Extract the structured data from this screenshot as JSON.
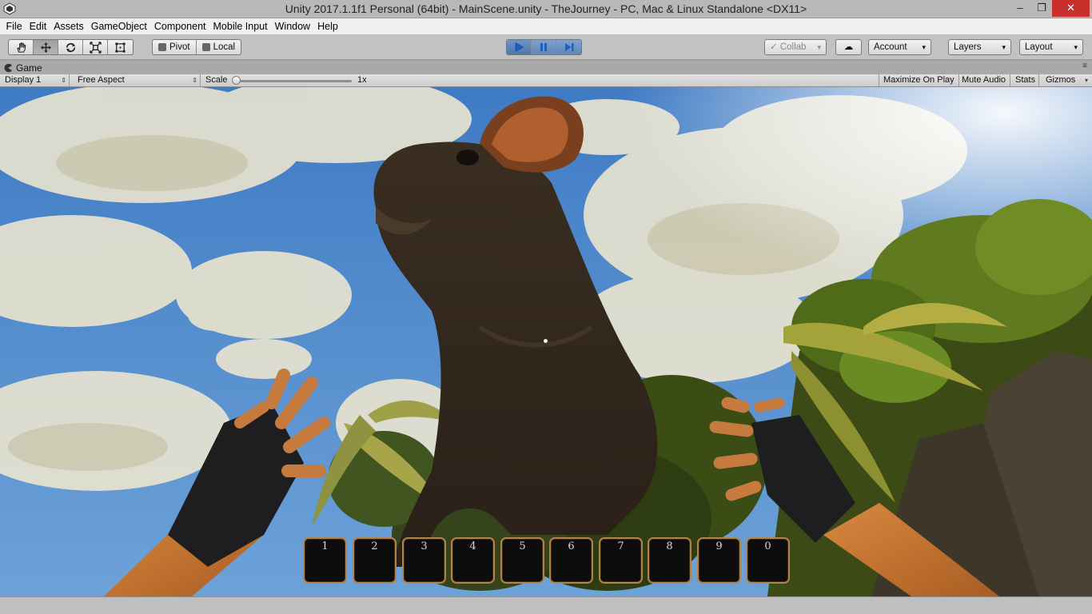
{
  "window": {
    "title": "Unity 2017.1.1f1 Personal (64bit) - MainScene.unity - TheJourney - PC, Mac & Linux Standalone <DX11>",
    "minimize": "–",
    "maximize": "❐",
    "close": "✕"
  },
  "menu": [
    "File",
    "Edit",
    "Assets",
    "GameObject",
    "Component",
    "Mobile Input",
    "Window",
    "Help"
  ],
  "toolbar": {
    "pivot_label": "Pivot",
    "local_label": "Local",
    "collab_label": "Collab",
    "account_label": "Account",
    "layers_label": "Layers",
    "layout_label": "Layout",
    "dropdown_arrow": "▾",
    "cloud_glyph": "☁"
  },
  "game_panel": {
    "tab_label": "Game",
    "tab_menu": "≡",
    "display_label": "Display 1",
    "aspect_label": "Free Aspect",
    "scale_label": "Scale",
    "scale_value": "1x",
    "scale_fraction": 0.0,
    "maximize_on_play": "Maximize On Play",
    "mute_audio": "Mute Audio",
    "stats": "Stats",
    "gizmos": "Gizmos",
    "updown_glyph": "⇕",
    "dropdown_glyph": "▾"
  },
  "hotbar": {
    "slots": [
      "1",
      "2",
      "3",
      "4",
      "5",
      "6",
      "7",
      "8",
      "9",
      "0"
    ]
  },
  "colors": {
    "play_accent": "#4c78b0",
    "slot_border": "#b3834b",
    "close_red": "#c7302b"
  }
}
